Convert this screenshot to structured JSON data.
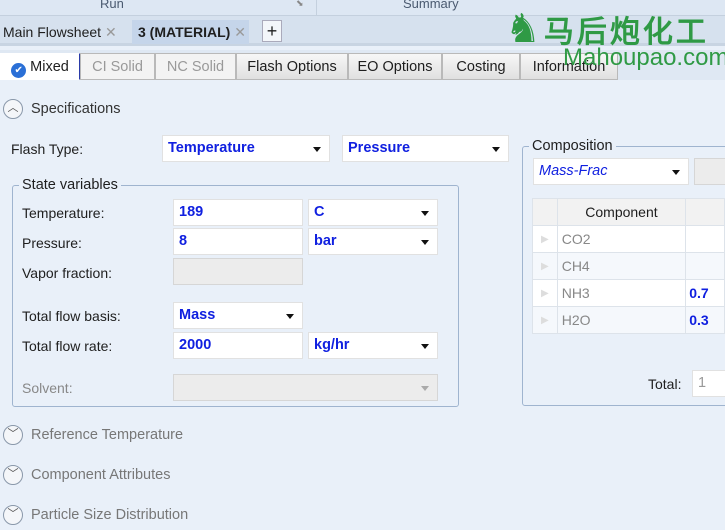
{
  "ribbon": {
    "run": "Run",
    "summary": "Summary"
  },
  "doc_tabs": [
    {
      "label": "Main Flowsheet"
    },
    {
      "label": "3 (MATERIAL)"
    }
  ],
  "form_tabs": [
    "Mixed",
    "CI Solid",
    "NC Solid",
    "Flash Options",
    "EO Options",
    "Costing",
    "Information"
  ],
  "specifications": {
    "title": "Specifications",
    "flash_type_label": "Flash Type:",
    "flash_type_1": "Temperature",
    "flash_type_2": "Pressure"
  },
  "state": {
    "legend": "State variables",
    "temperature_label": "Temperature:",
    "temperature": "189",
    "temperature_unit": "C",
    "pressure_label": "Pressure:",
    "pressure": "8",
    "pressure_unit": "bar",
    "vapor_label": "Vapor fraction:",
    "basis_label": "Total flow basis:",
    "basis": "Mass",
    "rate_label": "Total flow rate:",
    "rate": "2000",
    "rate_unit": "kg/hr",
    "solvent_label": "Solvent:"
  },
  "composition": {
    "legend": "Composition",
    "basis": "Mass-Frac",
    "column": "Component",
    "rows": [
      {
        "name": "CO2",
        "value": ""
      },
      {
        "name": "CH4",
        "value": ""
      },
      {
        "name": "NH3",
        "value": "0.7"
      },
      {
        "name": "H2O",
        "value": "0.3"
      }
    ],
    "total_label": "Total:",
    "total": "1"
  },
  "sections": [
    "Reference Temperature",
    "Component Attributes",
    "Particle Size Distribution"
  ],
  "watermark": {
    "cn": "马后炮化工",
    "en": "Mahoupao.com"
  },
  "colors": {
    "value_blue": "#1020e0",
    "background": "#e9f0f9"
  }
}
